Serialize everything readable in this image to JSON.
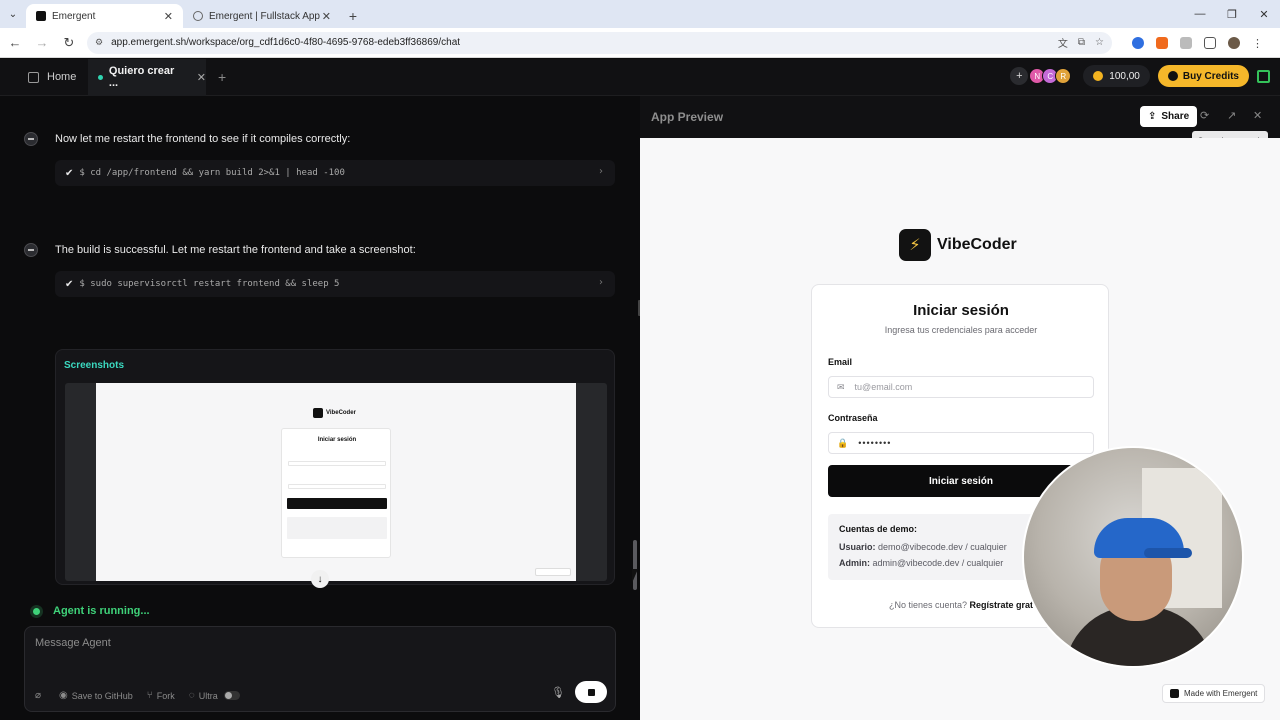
{
  "browser": {
    "tabs": [
      {
        "title": "Emergent",
        "active": true
      },
      {
        "title": "Emergent | Fullstack App",
        "active": false
      }
    ],
    "url": "app.emergent.sh/workspace/org_cdf1d6c0-4f80-4695-9768-edeb3ff36869/chat"
  },
  "topbar": {
    "home_label": "Home",
    "task_tab_label": "Quiero crear ...",
    "avatars": [
      "N",
      "C",
      "R"
    ],
    "credits": "100,00",
    "buy_label": "Buy Credits"
  },
  "chat": {
    "messages": [
      {
        "text": "Now let me restart the frontend to see if it compiles correctly:",
        "command": "$ cd /app/frontend && yarn build 2>&1 | head -100"
      },
      {
        "text": "The build is successful. Let me restart the frontend and take a screenshot:",
        "command": "$ sudo supervisorctl restart frontend && sleep 5"
      }
    ],
    "screenshots_label": "Screenshots",
    "thumb": {
      "brand": "VibeCoder",
      "title": "Iniciar sesión"
    },
    "status": "Agent is running...",
    "composer": {
      "placeholder": "Message Agent",
      "save_label": "Save to GitHub",
      "fork_label": "Fork",
      "ultra_label": "Ultra"
    }
  },
  "preview": {
    "title": "App Preview",
    "share_label": "Share",
    "tooltip": "Open in new tab",
    "brand": "VibeCoder",
    "card": {
      "title": "Iniciar sesión",
      "subtitle": "Ingresa tus credenciales para acceder",
      "email_label": "Email",
      "email_placeholder": "tu@email.com",
      "password_label": "Contraseña",
      "password_value": "••••••••",
      "button": "Iniciar sesión",
      "demo_title": "Cuentas de demo:",
      "demo_user_label": "Usuario:",
      "demo_user_value": "demo@vibecode.dev / cualquier",
      "demo_admin_label": "Admin:",
      "demo_admin_value": "admin@vibecode.dev / cualquier",
      "signup_text": "¿No tienes cuenta?",
      "signup_link": "Regístrate grat"
    },
    "made_with": "Made with Emergent"
  }
}
